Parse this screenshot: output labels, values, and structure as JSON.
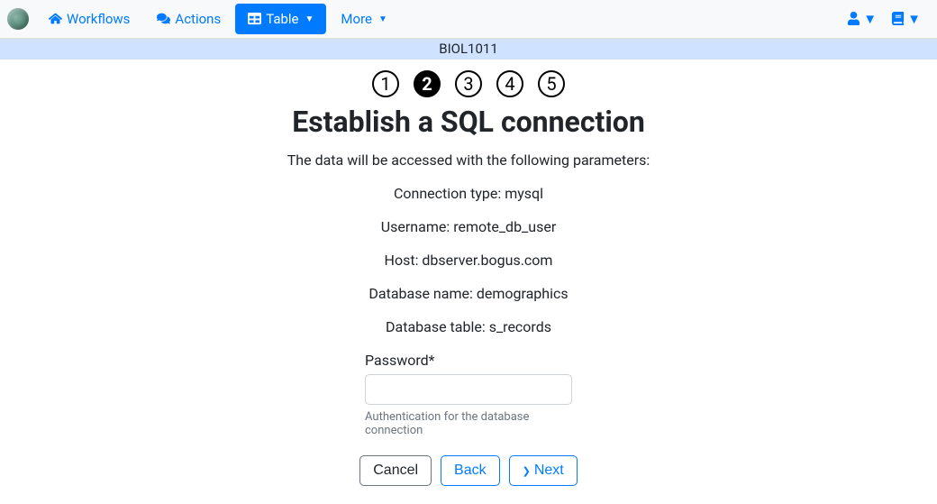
{
  "nav": {
    "workflows": "Workflows",
    "actions": "Actions",
    "table": "Table",
    "more": "More"
  },
  "context": {
    "title": "BIOL1011"
  },
  "wizard": {
    "steps": [
      "1",
      "2",
      "3",
      "4",
      "5"
    ],
    "current": 2,
    "title": "Establish a SQL connection",
    "subtitle": "The data will be accessed with the following parameters:",
    "params": {
      "connection_type": "Connection type: mysql",
      "username": "Username: remote_db_user",
      "host": "Host: dbserver.bogus.com",
      "db_name": "Database name: demographics",
      "db_table": "Database table: s_records"
    },
    "password_label": "Password*",
    "password_value": "",
    "password_help": "Authentication for the database connection",
    "buttons": {
      "cancel": "Cancel",
      "back": "Back",
      "next": "Next"
    }
  }
}
